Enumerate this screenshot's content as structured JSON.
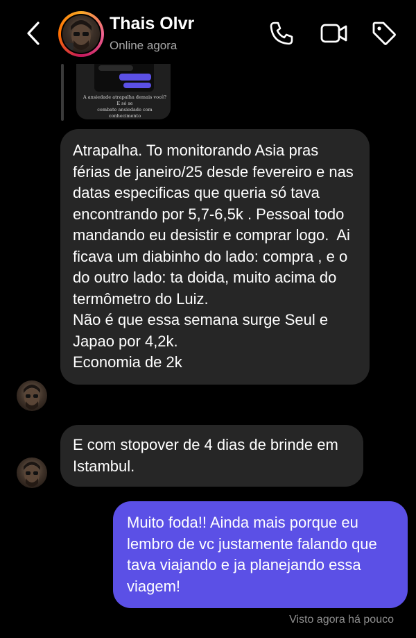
{
  "header": {
    "contact_name": "Thais Olvr",
    "contact_status": "Online agora",
    "icons": [
      "chevron-left-icon",
      "phone-icon",
      "video-camera-icon",
      "tag-icon"
    ]
  },
  "shared_post": {
    "caption_line1": "A ansiedade atrapalha demais você? E só se",
    "caption_line2": "combate ansiedade com conhecimento"
  },
  "messages": [
    {
      "type": "incoming",
      "paragraphs": [
        "Atrapalha. To monitorando Asia pras férias de janeiro/25 desde fevereiro e nas datas especificas que queria só tava encontrando por 5,7-6,5k . Pessoal todo mandando eu desistir e comprar logo.  Ai ficava um diabinho do lado: compra , e o do outro lado: ta doida, muito acima do termômetro do Luiz.",
        "Não é que essa semana surge Seul e Japao por 4,2k.",
        "Economia de 2k"
      ]
    },
    {
      "type": "incoming",
      "paragraphs": [
        "E com stopover de 4 dias de brinde em Istambul."
      ]
    },
    {
      "type": "outgoing",
      "paragraphs": [
        "Muito foda!! Ainda mais porque eu lembro de vc justamente falando que tava viajando e ja planejando essa viagem!"
      ]
    }
  ],
  "footer": {
    "seen_status": "Visto agora há pouco"
  },
  "colors": {
    "background": "#000000",
    "incoming_bubble": "#262626",
    "outgoing_bubble": "#5b50e6",
    "secondary_text": "#a8a8a8"
  }
}
